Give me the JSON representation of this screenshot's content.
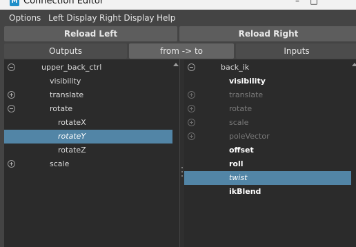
{
  "window": {
    "title": "Connection Editor",
    "icon_letter": "M",
    "minimize_glyph": "–",
    "maximize_glyph": "□"
  },
  "menu": [
    "Options",
    "Left Display",
    "Right Display",
    "Help"
  ],
  "toolbar": {
    "reload_left": "Reload Left",
    "reload_right": "Reload Right",
    "outputs": "Outputs",
    "direction": "from -> to",
    "inputs": "Inputs"
  },
  "left_tree": [
    {
      "label": "upper_back_ctrl",
      "toggle": "minus",
      "level": 0,
      "style": "normal",
      "selected": false
    },
    {
      "label": "visibility",
      "toggle": null,
      "level": 1,
      "style": "normal",
      "selected": false
    },
    {
      "label": "translate",
      "toggle": "plus",
      "level": 1,
      "style": "normal",
      "selected": false
    },
    {
      "label": "rotate",
      "toggle": "minus",
      "level": 1,
      "style": "normal",
      "selected": false
    },
    {
      "label": "rotateX",
      "toggle": null,
      "level": 2,
      "style": "normal",
      "selected": false
    },
    {
      "label": "rotateY",
      "toggle": null,
      "level": 2,
      "style": "italic",
      "selected": true
    },
    {
      "label": "rotateZ",
      "toggle": null,
      "level": 2,
      "style": "normal",
      "selected": false
    },
    {
      "label": "scale",
      "toggle": "plus",
      "level": 1,
      "style": "normal",
      "selected": false
    }
  ],
  "right_tree": [
    {
      "label": "back_ik",
      "toggle": "minus",
      "level": 0,
      "style": "normal",
      "selected": false
    },
    {
      "label": "visibility",
      "toggle": null,
      "level": 1,
      "style": "bold",
      "selected": false
    },
    {
      "label": "translate",
      "toggle": "plus",
      "level": 1,
      "style": "dim",
      "selected": false
    },
    {
      "label": "rotate",
      "toggle": "plus",
      "level": 1,
      "style": "dim",
      "selected": false
    },
    {
      "label": "scale",
      "toggle": "plus",
      "level": 1,
      "style": "dim",
      "selected": false
    },
    {
      "label": "poleVector",
      "toggle": "plus",
      "level": 1,
      "style": "dim",
      "selected": false
    },
    {
      "label": "offset",
      "toggle": null,
      "level": 1,
      "style": "bold",
      "selected": false
    },
    {
      "label": "roll",
      "toggle": null,
      "level": 1,
      "style": "bold",
      "selected": false
    },
    {
      "label": "twist",
      "toggle": null,
      "level": 1,
      "style": "italic",
      "selected": true
    },
    {
      "label": "ikBlend",
      "toggle": null,
      "level": 1,
      "style": "bold",
      "selected": false
    }
  ],
  "colors": {
    "selection": "#5285a6",
    "panel": "#2b2b2b",
    "chrome": "#444444",
    "button": "#5d5d5d"
  }
}
